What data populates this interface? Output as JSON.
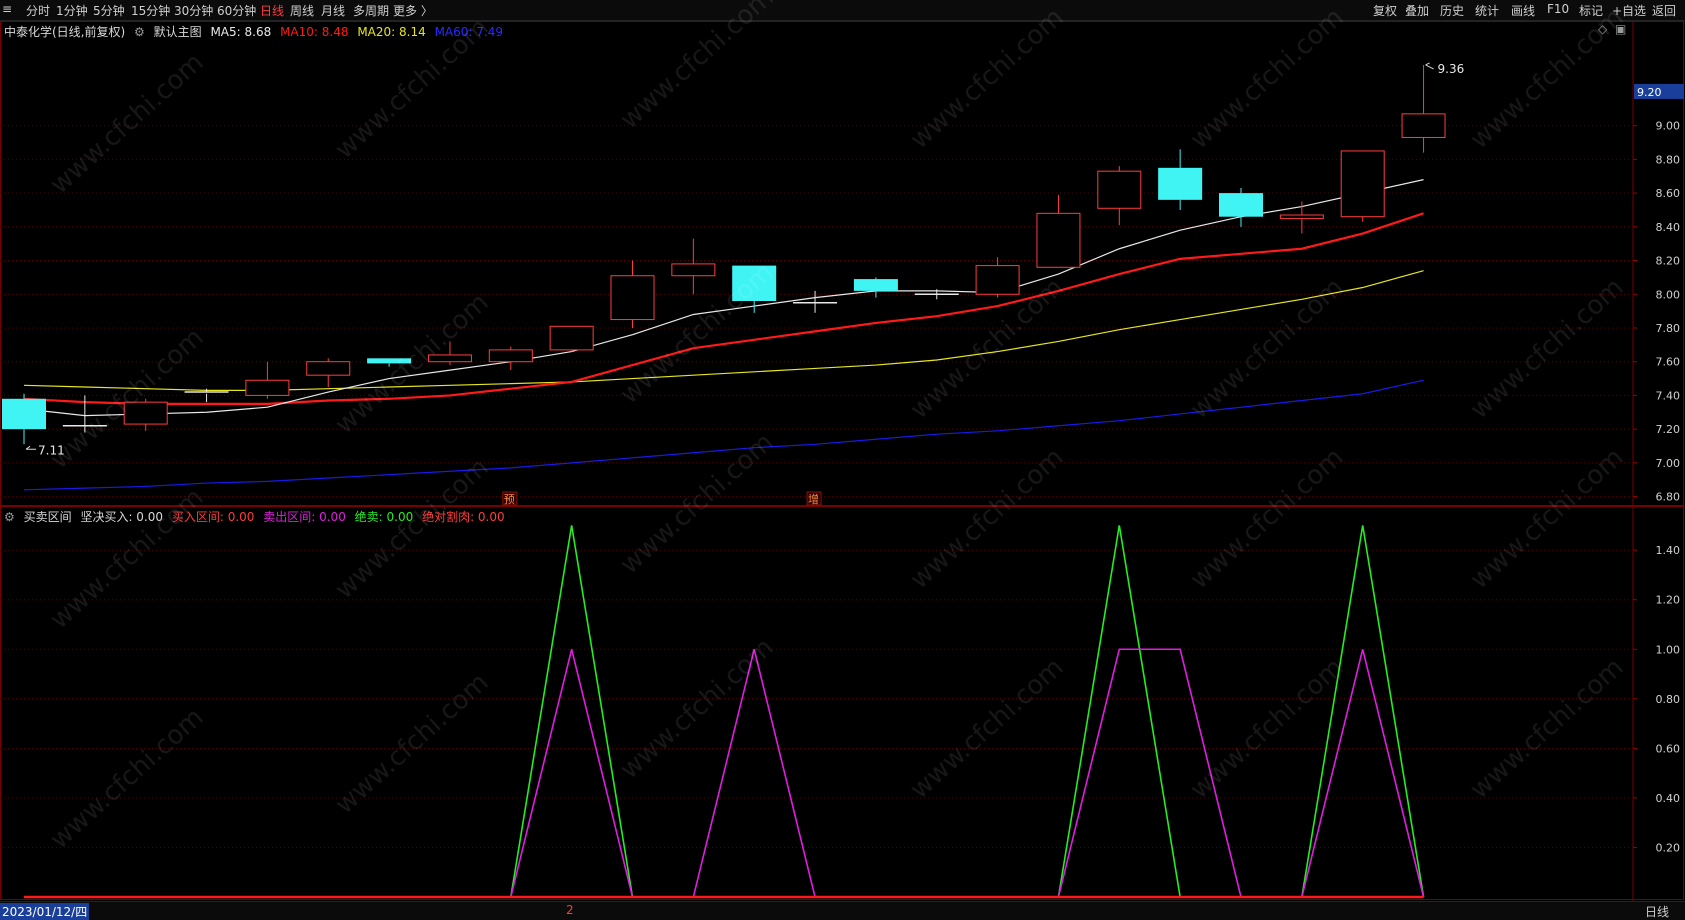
{
  "toolbar": {
    "left_icon": "≡",
    "periods": [
      "分时",
      "1分钟",
      "5分钟",
      "15分钟",
      "30分钟",
      "60分钟",
      "日线",
      "周线",
      "月线",
      "多周期",
      "更多 〉"
    ],
    "active_period": "日线",
    "right_items": [
      "复权",
      "叠加",
      "历史",
      "统计",
      "画线",
      "F10",
      "标记",
      "+自选",
      "返回"
    ]
  },
  "main_legend": {
    "stock": "中泰化学(日线,前复权)",
    "main_chart": "默认主图",
    "ma5": "MA5: 8.68",
    "ma10": "MA10: 8.48",
    "ma20": "MA20: 8.14",
    "ma60": "MA60: 7.49"
  },
  "indicator_legend": {
    "name": "买卖区间",
    "v1": "坚决买入: 0.00",
    "v2": "买入区间: 0.00",
    "v3": "卖出区间: 0.00",
    "v4": "绝卖: 0.00",
    "v5": "绝对割肉: 0.00"
  },
  "bottom_bar": {
    "date": "2023/01/12/四",
    "tick": "2",
    "period": "日线"
  },
  "colors": {
    "up": "#ff3c3c",
    "down": "#40f4f4",
    "ma5": "#e8e8e8",
    "ma10": "#ff1a1a",
    "ma20": "#e6e61e",
    "ma60": "#1a1ae6",
    "green": "#22ee22",
    "magenta": "#e01ee0"
  },
  "chart_data": [
    {
      "type": "candlestick",
      "title": "中泰化学(日线,前复权)",
      "ylim": [
        6.75,
        9.52
      ],
      "y_ticks": [
        6.8,
        7.0,
        7.2,
        7.4,
        7.6,
        7.8,
        8.0,
        8.2,
        8.4,
        8.6,
        8.8,
        9.0
      ],
      "current_price": "9.20",
      "high_label": "9.36",
      "low_label": "7.11",
      "candles": [
        {
          "o": 7.38,
          "h": 7.41,
          "l": 7.11,
          "c": 7.2
        },
        {
          "o": 7.22,
          "h": 7.4,
          "l": 7.18,
          "c": 7.22
        },
        {
          "o": 7.23,
          "h": 7.38,
          "l": 7.19,
          "c": 7.36
        },
        {
          "o": 7.42,
          "h": 7.44,
          "l": 7.36,
          "c": 7.41
        },
        {
          "o": 7.4,
          "h": 7.6,
          "l": 7.38,
          "c": 7.49
        },
        {
          "o": 7.52,
          "h": 7.62,
          "l": 7.45,
          "c": 7.6
        },
        {
          "o": 7.62,
          "h": 7.62,
          "l": 7.57,
          "c": 7.59
        },
        {
          "o": 7.6,
          "h": 7.72,
          "l": 7.58,
          "c": 7.64
        },
        {
          "o": 7.6,
          "h": 7.69,
          "l": 7.55,
          "c": 7.67
        },
        {
          "o": 7.67,
          "h": 7.81,
          "l": 7.66,
          "c": 7.81
        },
        {
          "o": 7.85,
          "h": 8.2,
          "l": 7.8,
          "c": 8.11
        },
        {
          "o": 8.11,
          "h": 8.33,
          "l": 8.0,
          "c": 8.18
        },
        {
          "o": 8.17,
          "h": 8.17,
          "l": 7.89,
          "c": 7.96
        },
        {
          "o": 7.95,
          "h": 8.02,
          "l": 7.89,
          "c": 7.95
        },
        {
          "o": 8.09,
          "h": 8.1,
          "l": 7.98,
          "c": 8.02
        },
        {
          "o": 8.0,
          "h": 8.03,
          "l": 7.97,
          "c": 8.0
        },
        {
          "o": 8.0,
          "h": 8.22,
          "l": 7.98,
          "c": 8.17
        },
        {
          "o": 8.16,
          "h": 8.59,
          "l": 8.16,
          "c": 8.48
        },
        {
          "o": 8.51,
          "h": 8.76,
          "l": 8.41,
          "c": 8.73
        },
        {
          "o": 8.75,
          "h": 8.86,
          "l": 8.5,
          "c": 8.56
        },
        {
          "o": 8.6,
          "h": 8.63,
          "l": 8.4,
          "c": 8.46
        },
        {
          "o": 8.45,
          "h": 8.55,
          "l": 8.36,
          "c": 8.47
        },
        {
          "o": 8.46,
          "h": 8.85,
          "l": 8.43,
          "c": 8.85
        },
        {
          "o": 8.93,
          "h": 9.36,
          "l": 8.84,
          "c": 9.07
        }
      ],
      "ma5": [
        7.32,
        7.28,
        7.29,
        7.3,
        7.33,
        7.42,
        7.5,
        7.55,
        7.6,
        7.66,
        7.76,
        7.88,
        7.93,
        7.98,
        8.02,
        8.02,
        8.01,
        8.12,
        8.27,
        8.38,
        8.46,
        8.52,
        8.6,
        8.68
      ],
      "ma10": [
        7.38,
        7.36,
        7.35,
        7.35,
        7.35,
        7.37,
        7.38,
        7.4,
        7.44,
        7.48,
        7.58,
        7.68,
        7.73,
        7.78,
        7.83,
        7.87,
        7.93,
        8.02,
        8.12,
        8.21,
        8.24,
        8.27,
        8.36,
        8.48
      ],
      "ma20": [
        7.46,
        7.45,
        7.44,
        7.43,
        7.43,
        7.44,
        7.45,
        7.46,
        7.47,
        7.48,
        7.5,
        7.52,
        7.54,
        7.56,
        7.58,
        7.61,
        7.66,
        7.72,
        7.79,
        7.85,
        7.91,
        7.97,
        8.04,
        8.14
      ],
      "ma60": [
        6.84,
        6.85,
        6.86,
        6.88,
        6.89,
        6.91,
        6.93,
        6.95,
        6.97,
        7.0,
        7.03,
        7.06,
        7.09,
        7.11,
        7.14,
        7.17,
        7.19,
        7.22,
        7.25,
        7.29,
        7.33,
        7.37,
        7.41,
        7.49
      ],
      "markers": [
        {
          "index": 8,
          "text": "预"
        },
        {
          "index": 13,
          "text": "增"
        }
      ]
    },
    {
      "type": "line",
      "title": "买卖区间",
      "ylim": [
        0,
        1.55
      ],
      "y_ticks": [
        0.2,
        0.4,
        0.6,
        0.8,
        1.0,
        1.2,
        1.4
      ],
      "series": [
        {
          "name": "绝卖",
          "color": "#22ee22",
          "values": [
            0,
            0,
            0,
            0,
            0,
            0,
            0,
            0,
            0,
            1.5,
            0,
            0,
            0,
            0,
            0,
            0,
            0,
            0,
            1.5,
            0,
            0,
            0,
            1.5,
            0
          ]
        },
        {
          "name": "卖出区间",
          "color": "#e01ee0",
          "values": [
            0,
            0,
            0,
            0,
            0,
            0,
            0,
            0,
            0,
            1,
            0,
            0,
            1,
            0,
            0,
            0,
            0,
            0,
            1,
            1,
            0,
            0,
            1,
            0
          ]
        },
        {
          "name": "绝对割肉",
          "color": "#ff1a1a",
          "values": [
            0,
            0,
            0,
            0,
            0,
            0,
            0,
            0,
            0,
            0,
            0,
            0,
            0,
            0,
            0,
            0,
            0,
            0,
            0,
            0,
            0,
            0,
            0,
            0
          ]
        }
      ]
    }
  ]
}
